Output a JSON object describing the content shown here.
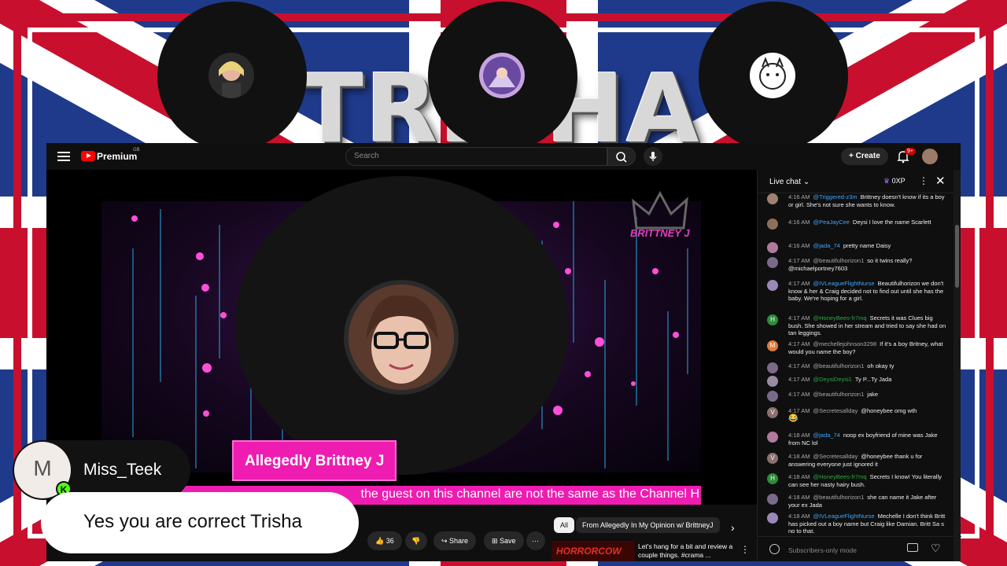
{
  "brand_banner": {
    "text": "TRISHA"
  },
  "youtube": {
    "logo_label": "Premium",
    "region": "GB",
    "search_placeholder": "Search",
    "create_label": "Create",
    "notification_count": "9+"
  },
  "stream": {
    "channel_logo_text": "BRITTNEY J",
    "nameplate": "Allegedly Brittney J",
    "ticker": "the guest on this channel are not the same as the Channel H"
  },
  "actions": {
    "like_count": "36",
    "share_label": "Share",
    "save_label": "Save"
  },
  "chips": [
    {
      "label": "All"
    },
    {
      "label": "From Allegedly In My Opinion w/ BrittneyJ"
    }
  ],
  "recommendation": {
    "thumb_text": "HORRORCOW",
    "title": "Let's hang for a bit and review a couple things. #crama ..."
  },
  "chat": {
    "title": "Live chat",
    "xp": "0XP",
    "footer_placeholder": "Subscribers-only mode",
    "messages": [
      {
        "time": "4:16 AM",
        "author": "@Triggered-z3m",
        "style": "blue",
        "text": "Brittney doesn't know if its a boy or girl. She's not sure she wants to know.",
        "avatar_color": "#a08070"
      },
      {
        "time": "4:16 AM",
        "author": "@PeaJayCee",
        "style": "blue",
        "text": "Deysi I love the name Scarlett",
        "avatar_color": "#8c6f5a"
      },
      {
        "time": "4:16 AM",
        "author": "@jada_74",
        "style": "blue",
        "text": "pretty name Daisy",
        "avatar_color": "#b07a9a"
      },
      {
        "time": "4:17 AM",
        "author": "@beautifulhorizon1",
        "style": "plain",
        "text": "so it twins really? @michaelportney7603",
        "avatar_color": "#7a6a8a"
      },
      {
        "time": "4:17 AM",
        "author": "@IVLeagueFlightNurse",
        "style": "blue",
        "text": "Beautifulhorizon we don't know & her & Craig decided not to find out until she has the baby. We're hoping for a girl.",
        "avatar_color": "#9a88b8"
      },
      {
        "time": "4:17 AM",
        "author": "@HoneyBees-fr7mq",
        "style": "mem",
        "text": "Secrets it was Clues big bush. She showed in her stream and tried to say she had on tan leggings.",
        "avatar_color": "#2e8b3a",
        "initial": "H"
      },
      {
        "time": "4:17 AM",
        "author": "@mechellejohnson3298",
        "style": "plain",
        "text": "If it's a boy Britney, what would you name the boy?",
        "avatar_color": "#e07b39",
        "initial": "M"
      },
      {
        "time": "4:17 AM",
        "author": "@beautifulhorizon1",
        "style": "plain",
        "text": "oh okay ty",
        "avatar_color": "#7a6a8a"
      },
      {
        "time": "4:17 AM",
        "author": "@DeysiDeysi1",
        "style": "mem",
        "text": "Ty P...Ty Jada",
        "avatar_color": "#9a8aa0"
      },
      {
        "time": "4:17 AM",
        "author": "@beautifulhorizon1",
        "style": "plain",
        "text": "jake",
        "avatar_color": "#7a6a8a"
      },
      {
        "time": "4:17 AM",
        "author": "@Secretesallday",
        "style": "plain",
        "text": "@honeybee omg wth",
        "avatar_color": "#8a7070",
        "initial": "V",
        "emoji": "😂"
      },
      {
        "time": "4:18 AM",
        "author": "@jada_74",
        "style": "blue",
        "text": "noop ex boyfriend of mine was Jake from NC lol",
        "avatar_color": "#b07a9a"
      },
      {
        "time": "4:18 AM",
        "author": "@Secretesallday",
        "style": "plain",
        "text": "@honeybee thank u for answering everyone just ignored it",
        "avatar_color": "#8a7070",
        "initial": "V"
      },
      {
        "time": "4:18 AM",
        "author": "@HoneyBees-fr7mq",
        "style": "mem",
        "text": "Secrets I know! You literally can see her nasty hairy bush.",
        "avatar_color": "#2e8b3a",
        "initial": "H"
      },
      {
        "time": "4:18 AM",
        "author": "@beautifulhorizon1",
        "style": "plain",
        "text": "she can name it Jake after your ex Jada",
        "avatar_color": "#7a6a8a"
      },
      {
        "time": "4:18 AM",
        "author": "@IVLeagueFlightNurse",
        "style": "blue",
        "text": "Mechelle I don't think Britt has picked out a boy name but Craig like Damian. Britt Sa s no to that.",
        "avatar_color": "#9a88b8"
      }
    ]
  },
  "kick_overlay": {
    "avatar_letter": "M",
    "badge": "K",
    "username": "Miss_Teek",
    "message": "Yes you are correct Trisha"
  },
  "colors": {
    "stream_pink": "#ee1cb0",
    "youtube_red": "#ff0000",
    "kick_green": "#53fc18"
  }
}
